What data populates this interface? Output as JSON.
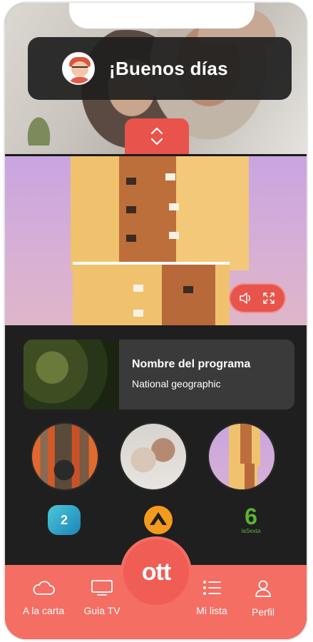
{
  "greeting": {
    "text": "¡Buenos días"
  },
  "program": {
    "title": "Nombre del programa",
    "subtitle": "National geographic"
  },
  "channels": [
    {
      "label": "2"
    },
    {
      "label": ""
    },
    {
      "label": "6",
      "sublabel": "laSexta"
    }
  ],
  "nav": {
    "items": [
      {
        "label": "A la carta",
        "icon": "cloud-icon"
      },
      {
        "label": "Guia TV",
        "icon": "tv-icon"
      },
      {
        "label": "Mi lista",
        "icon": "list-icon"
      },
      {
        "label": "Perfil",
        "icon": "user-icon"
      }
    ],
    "center_label": "ott"
  },
  "colors": {
    "accent": "#f46e63",
    "dark": "#1f1f1f",
    "card": "#3a3a3a",
    "laSexta": "#59b534",
    "antena3": "#f39b1f"
  }
}
